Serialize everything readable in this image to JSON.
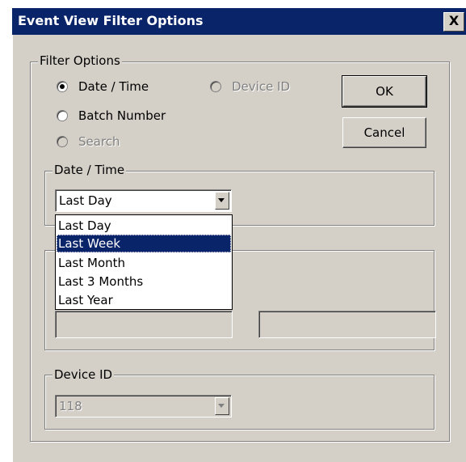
{
  "window": {
    "title": "Event View Filter Options",
    "close_symbol": "X"
  },
  "filter_options": {
    "label": "Filter Options",
    "radios": [
      {
        "label": "Date / Time",
        "checked": true,
        "enabled": true
      },
      {
        "label": "Device ID",
        "checked": false,
        "enabled": false
      },
      {
        "label": "Batch Number",
        "checked": false,
        "enabled": true
      },
      {
        "label": "Search",
        "checked": false,
        "enabled": false
      }
    ]
  },
  "buttons": {
    "ok": "OK",
    "cancel": "Cancel"
  },
  "date_time": {
    "label": "Date / Time",
    "selected": "Last Day",
    "options": [
      "Last Day",
      "Last Week",
      "Last Month",
      "Last 3 Months",
      "Last Year"
    ],
    "highlighted": "Last Week"
  },
  "device_id": {
    "label": "Device ID",
    "value": "118"
  },
  "colors": {
    "dialog_bg": "#d4d0c8",
    "title_bar": "#0a246a",
    "highlight": "#0a246a"
  }
}
